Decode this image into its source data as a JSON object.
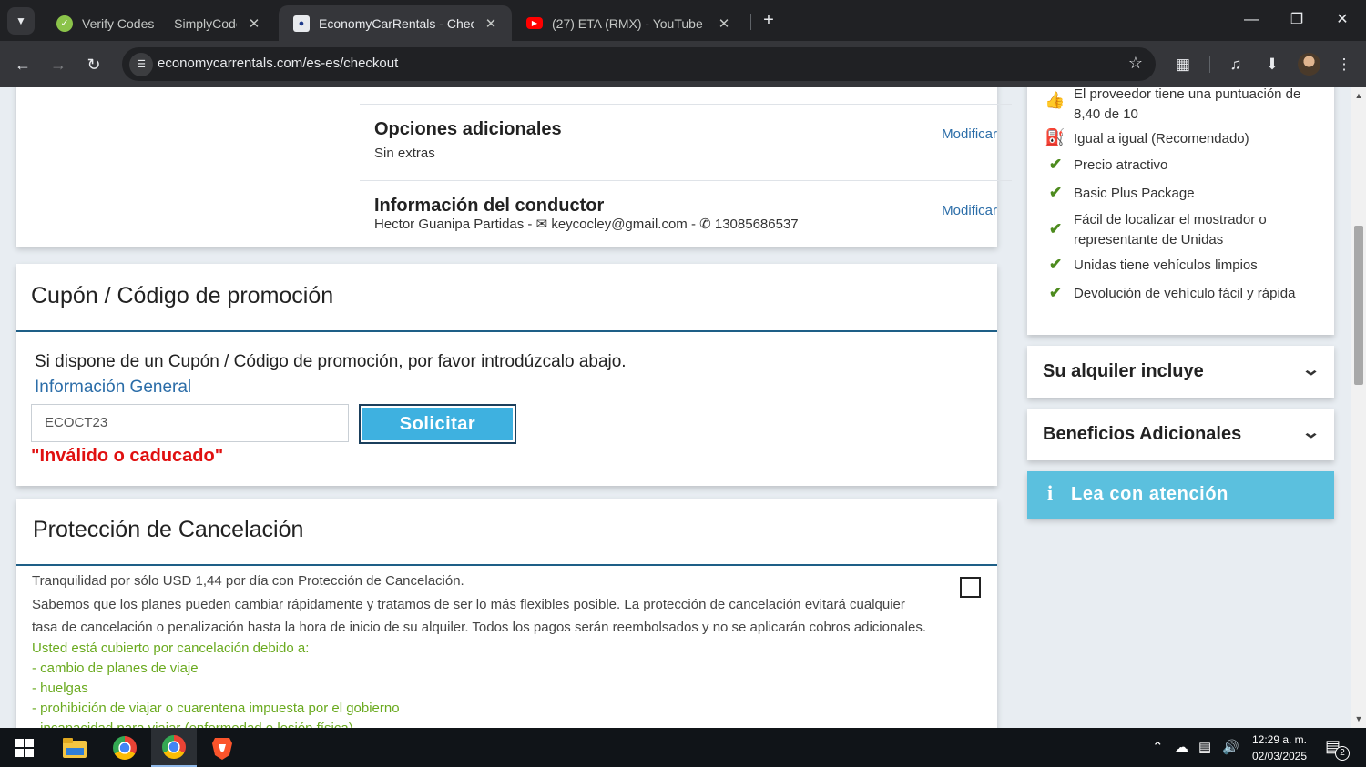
{
  "browser": {
    "tabs": [
      {
        "title": "Verify Codes — SimplyCodes",
        "active": false
      },
      {
        "title": "EconomyCarRentals - Checkout",
        "active": true
      },
      {
        "title": "(27) ETA (RMX) - YouTube",
        "active": false
      }
    ],
    "url": "economycarrentals.com/es-es/checkout"
  },
  "summary": {
    "extras": {
      "title": "Opciones adicionales",
      "value": "Sin extras",
      "action": "Modificar"
    },
    "driver": {
      "title": "Información del conductor",
      "name": "Hector Guanipa Partidas - ",
      "email": "keycocley@gmail.com",
      "sep": " - ",
      "phone": "13085686537",
      "action": "Modificar"
    }
  },
  "coupon": {
    "heading": "Cupón / Código de promoción",
    "instruction": "Si dispone de un Cupón / Código de promoción, por favor introdúzcalo abajo.",
    "link": "Información General",
    "input_value": "ECOCT23",
    "button": "Solicitar",
    "error": "\"Inválido o caducado\""
  },
  "cancel_protection": {
    "heading": "Protección de Cancelación",
    "price_line": "Tranquilidad por sólo USD 1,44 por día con Protección de Cancelación.",
    "desc_1": "Sabemos que los planes pueden cambiar rápidamente y tratamos de ser lo más flexibles posible. La protección de cancelación evitará cualquier",
    "desc_2": "tasa de cancelación o penalización hasta la hora de inicio de su alquiler. Todos los pagos serán reembolsados y no se aplicarán cobros adicionales.",
    "covered_title": "Usted está cubierto por cancelación debido a:",
    "covered": [
      "- cambio de planes de viaje",
      "- huelgas",
      "- prohibición de viajar o cuarentena impuesta por el gobierno",
      "- incapacidad para viajar (enfermedad o lesión física)"
    ],
    "checked": false
  },
  "sidebar": {
    "features": [
      {
        "icon": "thumbs-up-icon",
        "line1": "El proveedor tiene una puntuación de",
        "line2": "8,40 de 10"
      },
      {
        "icon": "fuel-icon",
        "line1": "Igual a igual (Recomendado)"
      },
      {
        "icon": "check-icon",
        "line1": "Precio atractivo"
      },
      {
        "icon": "check-icon",
        "line1": "Basic Plus Package"
      },
      {
        "icon": "check-icon",
        "line1": "Fácil de localizar el mostrador o",
        "line2": "representante de Unidas"
      },
      {
        "icon": "check-icon",
        "line1": "Unidas tiene vehículos limpios"
      },
      {
        "icon": "check-icon",
        "line1": "Devolución de vehículo fácil y rápida"
      }
    ],
    "rental_includes": "Su alquiler incluye",
    "additional_benefits": "Beneficios Adicionales",
    "notice": "Lea con atención"
  },
  "taskbar": {
    "time": "12:29 a. m.",
    "date": "02/03/2025",
    "notifications": "2"
  },
  "colors": {
    "accent_blue": "#3eb1e0",
    "link_blue": "#2b6da8",
    "error_red": "#e01010",
    "green": "#6aaa1f",
    "notice_bg": "#5bc0de"
  }
}
